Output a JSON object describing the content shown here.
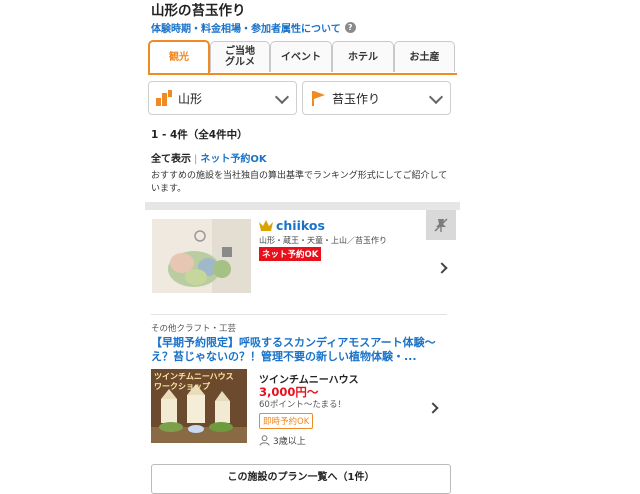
{
  "page": {
    "title": "山形の苔玉作り",
    "info_link": "体験時期・料金相場・参加者属性について",
    "help_icon": "?"
  },
  "tabs": [
    {
      "label": "観光",
      "active": true
    },
    {
      "label": "ご当地\nグルメ",
      "active": false
    },
    {
      "label": "イベント",
      "active": false
    },
    {
      "label": "ホテル",
      "active": false
    },
    {
      "label": "お土産",
      "active": false
    }
  ],
  "filters": {
    "area": {
      "value": "山形",
      "icon": "map-pin-icon"
    },
    "activity": {
      "value": "苔玉作り",
      "icon": "flag-icon"
    }
  },
  "results": {
    "count_text": "1 - 4件（全4件中）",
    "filter_all": "全て表示",
    "filter_sep": "|",
    "filter_online": "ネット予約OK",
    "description": "おすすめの施設を当社独自の算出基準でランキング形式にしてご紹介しています。"
  },
  "listing1": {
    "name": "chiikos",
    "area": "山形・蔵王・天童・上山／苔玉作り",
    "badge": "ネット予約OK"
  },
  "listing2": {
    "category": "その他クラフト・工芸",
    "plan_title": "【早期予約限定】呼吸するスカンディアモスアート体験〜え？苔じゃないの？！管理不要の新しい植物体験・...",
    "image_caption": "ツインチムニーハウス ワークショップ",
    "vendor": "ツインチムニーハウス",
    "price": "3,000円〜",
    "points": "60ポイント〜たまる！",
    "badge": "即時予約OK",
    "age": "3歳以上",
    "more_button": "この施設のプラン一覧へ（1件）"
  },
  "colors": {
    "accent": "#f08a24",
    "link": "#1a73c9",
    "red": "#e8101a"
  }
}
